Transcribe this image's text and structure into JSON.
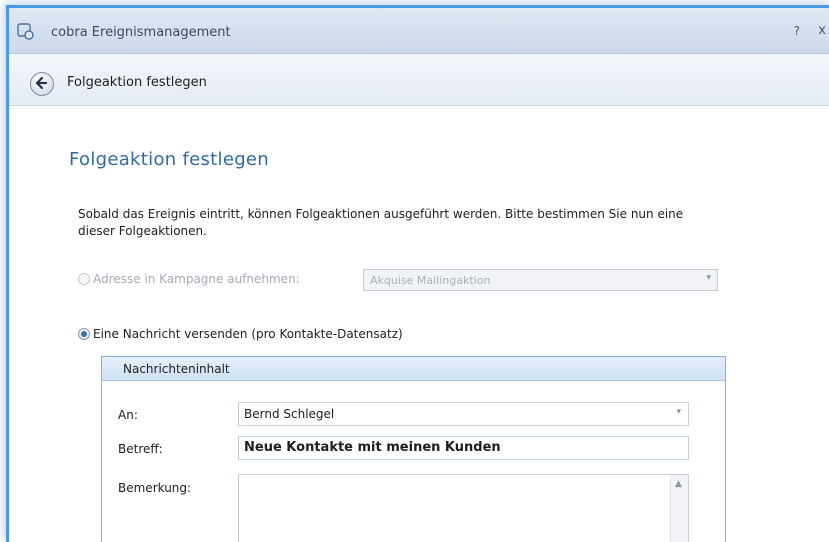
{
  "window": {
    "title": "cobra Ereignismanagement",
    "help_glyph": "?",
    "close_glyph": "x"
  },
  "nav": {
    "title": "Folgeaktion festlegen",
    "back_icon": "back-arrow-icon"
  },
  "page": {
    "heading": "Folgeaktion festlegen",
    "intro": "Sobald das Ereignis eintritt, können Folgeaktionen ausgeführt werden. Bitte bestimmen Sie nun eine dieser Folgeaktionen."
  },
  "options": {
    "campaign": {
      "label": "Adresse in Kampagne aufnehmen:",
      "selected": false,
      "enabled": false,
      "combo_value": "Akquise Mailingaktion"
    },
    "message": {
      "label": "Eine Nachricht versenden (pro Kontakte-Datensatz)",
      "selected": true,
      "enabled": true
    }
  },
  "message_group": {
    "title": "Nachrichteninhalt",
    "to_label": "An:",
    "to_value": "Bernd Schlegel",
    "subject_label": "Betreff:",
    "subject_value": "Neue Kontakte mit meinen Kunden",
    "remark_label": "Bemerkung:",
    "remark_value": ""
  },
  "colors": {
    "accent": "#2f6aa8",
    "window_border": "#4a9be4",
    "group_border": "#7fb0df"
  }
}
